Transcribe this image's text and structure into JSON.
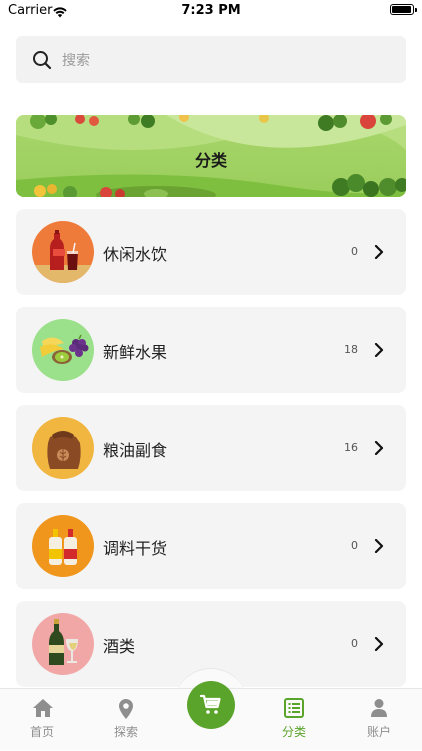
{
  "status_bar": {
    "carrier": "Carrier",
    "time": "7:23 PM",
    "battery_level": 1.0
  },
  "search": {
    "placeholder": "搜索",
    "icon": "search-icon"
  },
  "banner": {
    "title": "分类"
  },
  "categories": [
    {
      "label": "休闲水饮",
      "count": "0",
      "icon": "drinks-icon",
      "color": "#ef7b3b"
    },
    {
      "label": "新鲜水果",
      "count": "18",
      "icon": "fruit-icon",
      "color": "#9be08a"
    },
    {
      "label": "粮油副食",
      "count": "16",
      "icon": "grain-sack-icon",
      "color": "#f0b640"
    },
    {
      "label": "调料干货",
      "count": "0",
      "icon": "condiment-bottles-icon",
      "color": "#f0961c"
    },
    {
      "label": "酒类",
      "count": "0",
      "icon": "wine-icon",
      "color": "#f2a7a7"
    }
  ],
  "tabbar": {
    "tabs": [
      {
        "label": "首页",
        "icon": "home-icon",
        "active": false
      },
      {
        "label": "探索",
        "icon": "location-pin-icon",
        "active": false
      },
      {
        "label": "分类",
        "icon": "list-icon",
        "active": true
      },
      {
        "label": "账户",
        "icon": "user-icon",
        "active": false
      }
    ],
    "cart_icon": "cart-icon"
  },
  "colors": {
    "accent": "#5aa42b",
    "card_bg": "#f4f4f4",
    "search_bg": "#f2f2f2"
  }
}
